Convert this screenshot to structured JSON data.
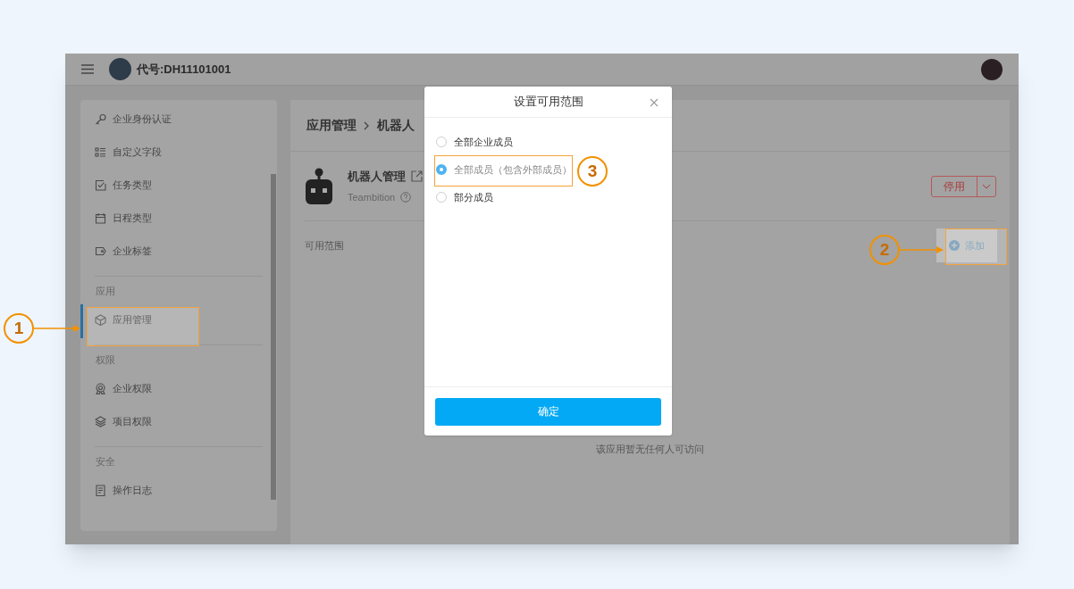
{
  "header": {
    "title": "代号:DH11101001"
  },
  "sidebar": {
    "groups": [
      {
        "items": [
          {
            "label": "企业身份认证",
            "selected": false
          },
          {
            "label": "自定义字段",
            "selected": false
          },
          {
            "label": "任务类型",
            "selected": false
          },
          {
            "label": "日程类型",
            "selected": false
          },
          {
            "label": "企业标签",
            "selected": false
          }
        ]
      },
      {
        "heading": "应用",
        "items": [
          {
            "label": "应用管理",
            "selected": true
          }
        ]
      },
      {
        "heading": "权限",
        "items": [
          {
            "label": "企业权限",
            "selected": false
          },
          {
            "label": "项目权限",
            "selected": false
          }
        ]
      },
      {
        "heading": "安全",
        "items": [
          {
            "label": "操作日志",
            "selected": false
          }
        ]
      }
    ]
  },
  "main": {
    "breadcrumb": [
      "应用管理",
      "机器人"
    ],
    "app": {
      "name": "机器人管理",
      "vendor": "Teambition"
    },
    "disable_button": "停用",
    "section_label": "可用范围",
    "add_button": "添加",
    "empty_text": "该应用暂无任何人可访问"
  },
  "dialog": {
    "title": "设置可用范围",
    "options": [
      {
        "label": "全部企业成员",
        "selected": false
      },
      {
        "label": "全部成员（包含外部成员）",
        "selected": true
      },
      {
        "label": "部分成员",
        "selected": false
      }
    ],
    "confirm": "确定"
  },
  "annotations": [
    {
      "label": "1"
    },
    {
      "label": "2"
    },
    {
      "label": "3"
    }
  ]
}
